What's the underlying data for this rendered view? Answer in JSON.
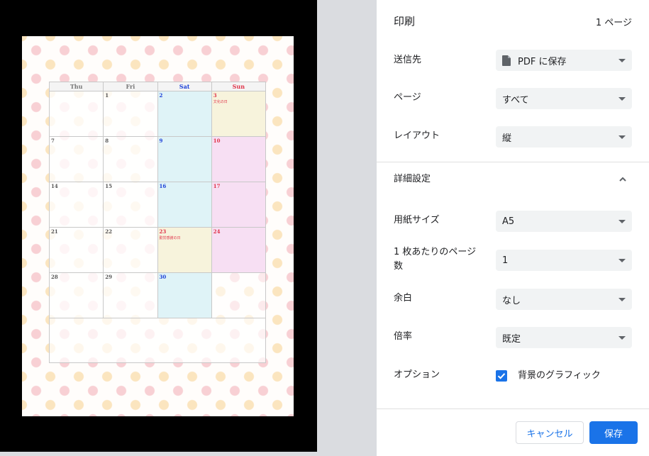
{
  "preview": {
    "calendar": {
      "headers": [
        {
          "label": "Thu",
          "cls": "wd"
        },
        {
          "label": "Fri",
          "cls": "wd"
        },
        {
          "label": "Sat",
          "cls": "sat"
        },
        {
          "label": "Sun",
          "cls": "sun"
        }
      ],
      "rows": [
        [
          {
            "day": "",
            "cls": ""
          },
          {
            "day": "1",
            "cls": ""
          },
          {
            "day": "2",
            "cls": "sat"
          },
          {
            "day": "3",
            "cls": "hol",
            "holiday": "文化の日"
          }
        ],
        [
          {
            "day": "7",
            "cls": ""
          },
          {
            "day": "8",
            "cls": ""
          },
          {
            "day": "9",
            "cls": "sat"
          },
          {
            "day": "10",
            "cls": "sun"
          }
        ],
        [
          {
            "day": "14",
            "cls": ""
          },
          {
            "day": "15",
            "cls": ""
          },
          {
            "day": "16",
            "cls": "sat"
          },
          {
            "day": "17",
            "cls": "sun"
          }
        ],
        [
          {
            "day": "21",
            "cls": ""
          },
          {
            "day": "22",
            "cls": ""
          },
          {
            "day": "23",
            "cls": "hol",
            "holiday": "勤労感謝の日"
          },
          {
            "day": "24",
            "cls": "sun"
          }
        ],
        [
          {
            "day": "28",
            "cls": ""
          },
          {
            "day": "29",
            "cls": ""
          },
          {
            "day": "30",
            "cls": "sat"
          },
          {
            "day": "",
            "cls": "blank"
          }
        ]
      ]
    }
  },
  "panel": {
    "title": "印刷",
    "page_count": "1 ページ",
    "destination": {
      "label": "送信先",
      "value": "PDF に保存"
    },
    "pages": {
      "label": "ページ",
      "value": "すべて"
    },
    "layout": {
      "label": "レイアウト",
      "value": "縦"
    },
    "advanced": {
      "label": "詳細設定"
    },
    "paper_size": {
      "label": "用紙サイズ",
      "value": "A5"
    },
    "pages_per_sheet": {
      "label": "1 枚あたりのページ数",
      "value": "1"
    },
    "margins": {
      "label": "余白",
      "value": "なし"
    },
    "scale": {
      "label": "倍率",
      "value": "既定"
    },
    "options": {
      "label": "オプション",
      "checkbox_label": "背景のグラフィック",
      "checked": true
    }
  },
  "buttons": {
    "cancel": "キャンセル",
    "save": "保存"
  },
  "colors": {
    "accent": "#1a73e8",
    "select_bg": "#f1f3f4",
    "saturday": "#1a3fd8",
    "sunday": "#e0344a"
  }
}
